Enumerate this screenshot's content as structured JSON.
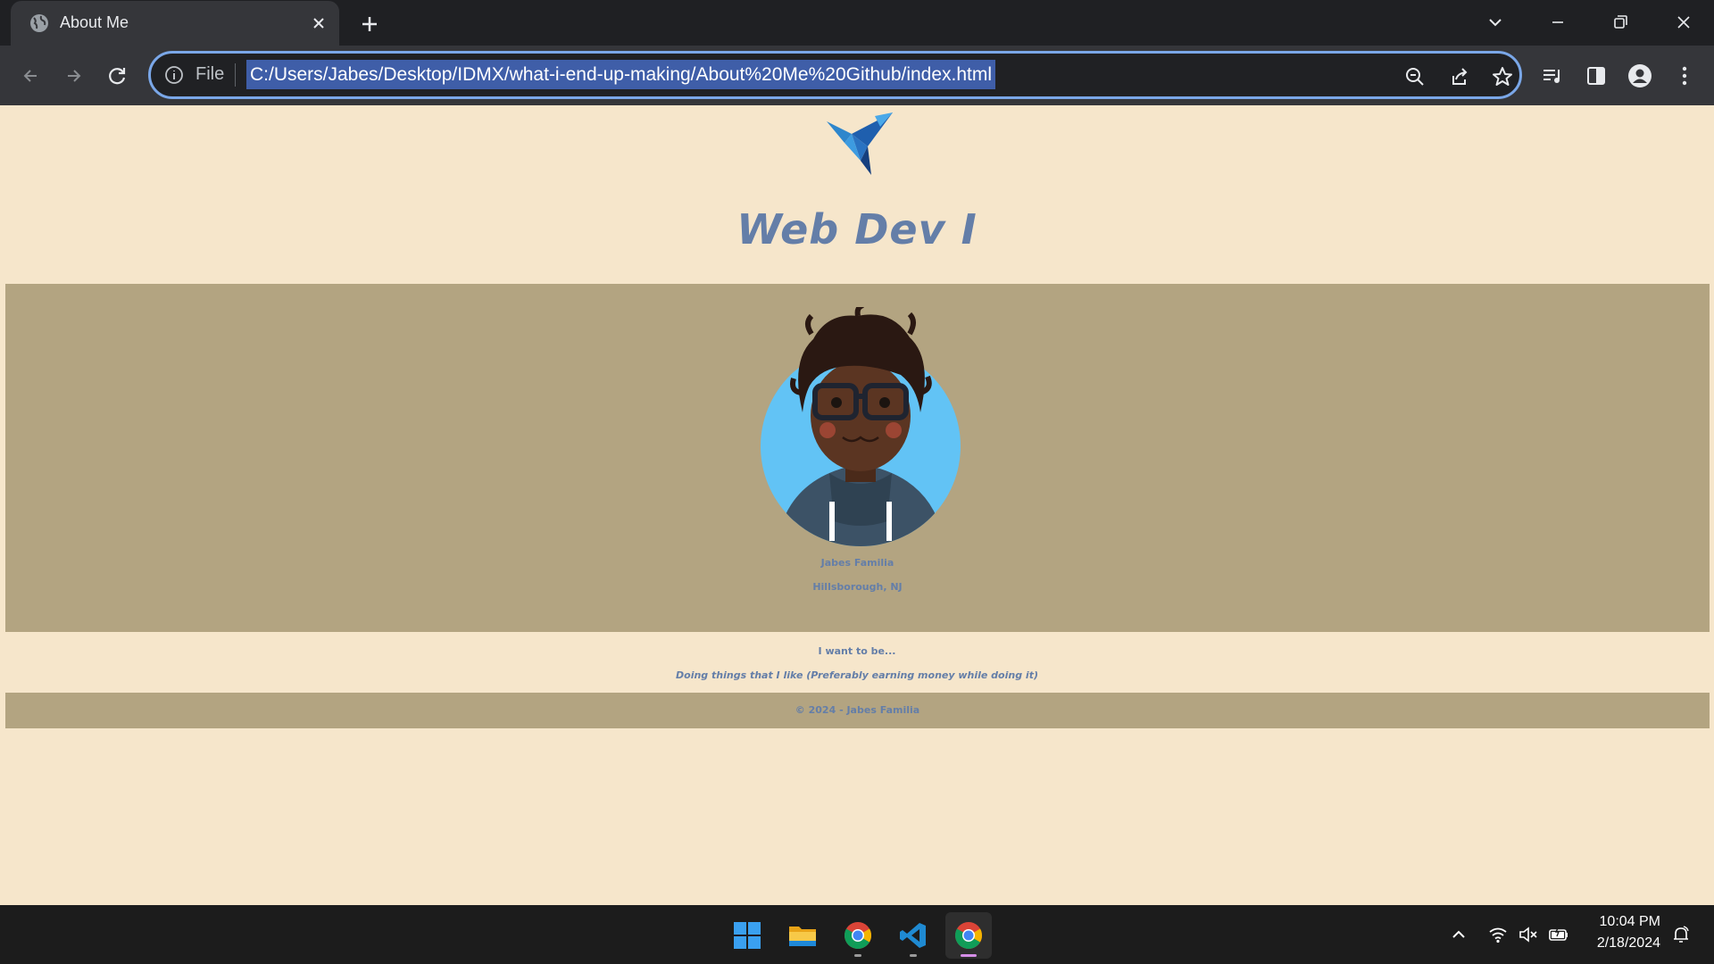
{
  "browser": {
    "tab": {
      "title": "About Me",
      "favicon": "globe-icon"
    },
    "omnibox": {
      "scheme_label": "File",
      "url": "C:/Users/Jabes/Desktop/IDMX/what-i-end-up-making/About%20Me%20Github/index.html"
    },
    "theme": {
      "frame": "#1f2023",
      "toolbar": "#35363a",
      "omnibox_focus": "#7aa7e8",
      "url_selection": "#3f5ea8"
    }
  },
  "page": {
    "logo": "origami-bird-logo",
    "title": "Web Dev I",
    "profile": {
      "avatar": "avatar-illustration",
      "name": "Jabes Familia",
      "location": "Hillsborough, NJ"
    },
    "aspiration": {
      "heading": "I want to be...",
      "text": "Doing things that I like (Preferably earning money while doing it)"
    },
    "footer": {
      "copyright": "© 2024 - Jabes Familia"
    },
    "colors": {
      "background": "#f6e6cb",
      "band": "#b3a481",
      "text": "#647ea8"
    }
  },
  "taskbar": {
    "apps": [
      "start-button",
      "file-explorer",
      "chrome",
      "vscode",
      "chrome"
    ],
    "clock": {
      "time": "10:04 PM",
      "date": "2/18/2024"
    }
  }
}
